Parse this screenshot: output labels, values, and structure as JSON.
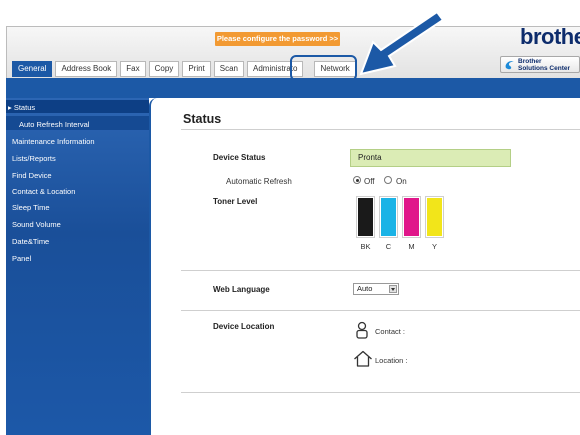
{
  "banner": {
    "warning": "Please configure the password >>",
    "logo": "brother"
  },
  "solutions_center": {
    "line1": "Brother",
    "line2": "Solutions Center"
  },
  "tabs": [
    {
      "label": "General",
      "active": true
    },
    {
      "label": "Address Book",
      "active": false
    },
    {
      "label": "Fax",
      "active": false
    },
    {
      "label": "Copy",
      "active": false
    },
    {
      "label": "Print",
      "active": false
    },
    {
      "label": "Scan",
      "active": false
    },
    {
      "label": "Administrato",
      "active": false
    },
    {
      "label": "Network",
      "active": false
    }
  ],
  "sidebar": {
    "items": [
      {
        "label": "▸ Status"
      },
      {
        "label": "Auto Refresh Interval"
      },
      {
        "label": "Maintenance Information"
      },
      {
        "label": "Lists/Reports"
      },
      {
        "label": "Find Device"
      },
      {
        "label": "Contact & Location"
      },
      {
        "label": "Sleep Time"
      },
      {
        "label": "Sound Volume"
      },
      {
        "label": "Date&Time"
      },
      {
        "label": "Panel"
      }
    ]
  },
  "main": {
    "title": "Status",
    "device_status": {
      "label": "Device Status",
      "value": "Pronta"
    },
    "auto_refresh": {
      "label": "Automatic Refresh",
      "off": "Off",
      "on": "On",
      "selected": "Off"
    },
    "toner": {
      "label": "Toner Level",
      "cartridges": [
        {
          "name": "BK",
          "color": "#1a1a1a",
          "level": 1.0
        },
        {
          "name": "C",
          "color": "#1ab3e6",
          "level": 1.0
        },
        {
          "name": "M",
          "color": "#e0168a",
          "level": 1.0
        },
        {
          "name": "Y",
          "color": "#f2e51a",
          "level": 1.0
        }
      ]
    },
    "web_language": {
      "label": "Web Language",
      "value": "Auto"
    },
    "device_location": {
      "label": "Device Location",
      "contact": "Contact :",
      "location": "Location :"
    }
  },
  "colors": {
    "accent": "#1c59a6",
    "warning": "#f29a33",
    "status_bg": "#dbecb5"
  }
}
